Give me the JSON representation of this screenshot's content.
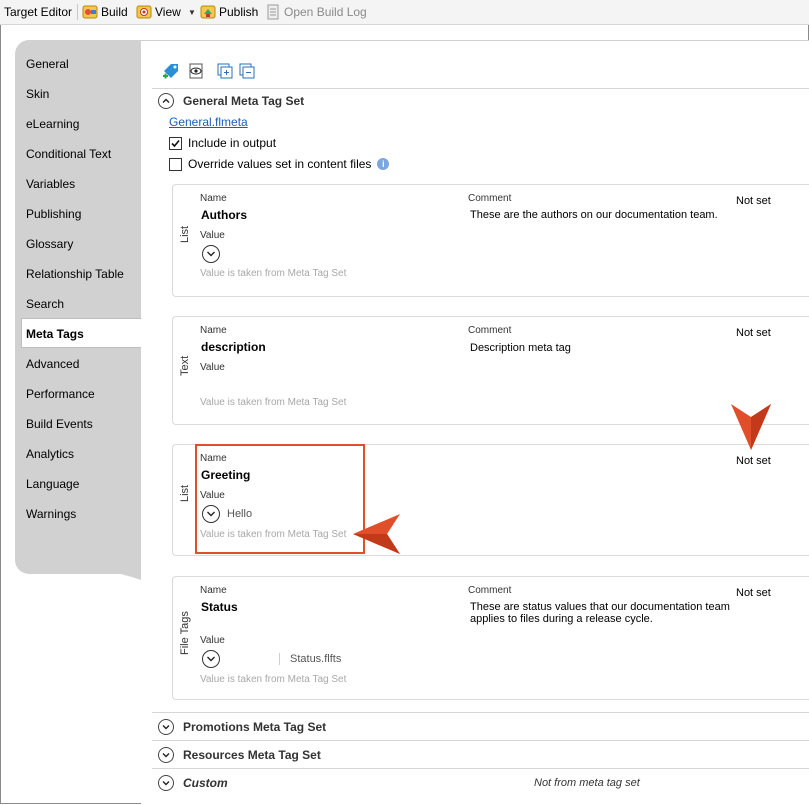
{
  "toolbar": {
    "target_editor": "Target Editor",
    "build": "Build",
    "view": "View",
    "publish": "Publish",
    "open_build_log": "Open Build Log"
  },
  "nav": {
    "items": [
      "General",
      "Skin",
      "eLearning",
      "Conditional Text",
      "Variables",
      "Publishing",
      "Glossary",
      "Relationship Table",
      "Search",
      "Meta Tags",
      "Advanced",
      "Performance",
      "Build Events",
      "Analytics",
      "Language",
      "Warnings"
    ],
    "active": "Meta Tags"
  },
  "main": {
    "general_set_title": "General Meta Tag Set",
    "file_link": "General.flmeta",
    "include_output": "Include in output",
    "override_values": "Override values set in content files",
    "info_glyph": "i",
    "labels": {
      "name": "Name",
      "comment": "Comment",
      "value": "Value"
    },
    "hint": "Value is taken from Meta Tag Set",
    "tags": [
      {
        "type": "List",
        "name": "Authors",
        "comment": "These are the authors on our documentation team.",
        "status": "Not set",
        "value": ""
      },
      {
        "type": "Text",
        "name": "description",
        "comment": "Description meta tag",
        "status": "Not set",
        "value": ""
      },
      {
        "type": "List",
        "name": "Greeting",
        "comment": "",
        "status": "Not set",
        "value": "Hello"
      },
      {
        "type": "File Tags",
        "name": "Status",
        "comment": "These are status values that our documentation team applies to files during a release cycle.",
        "status": "Not set",
        "value": "Status.flfts"
      }
    ],
    "sets": [
      {
        "title": "Promotions Meta Tag Set"
      },
      {
        "title": "Resources Meta Tag Set"
      },
      {
        "title": "Custom",
        "note": "Not from meta tag set"
      }
    ]
  },
  "colors": {
    "accent_orange": "#e04e2a",
    "link_blue": "#1a5fb4",
    "nav_bg": "#d1d1d1"
  }
}
